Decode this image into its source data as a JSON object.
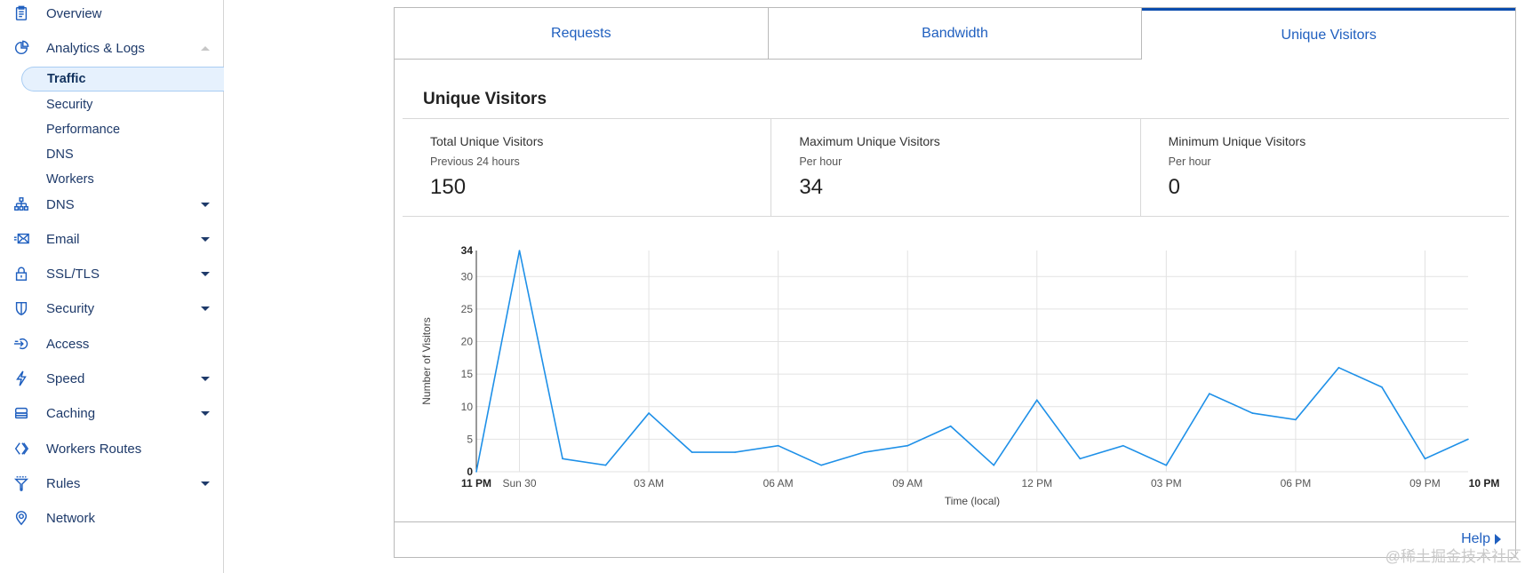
{
  "sidebar": {
    "items": [
      {
        "label": "Overview",
        "icon": "clipboard-icon",
        "caret": "none"
      },
      {
        "label": "Analytics & Logs",
        "icon": "pie-chart-icon",
        "caret": "up"
      },
      {
        "label": "DNS",
        "icon": "sitemap-icon",
        "caret": "down"
      },
      {
        "label": "Email",
        "icon": "mail-icon",
        "caret": "down"
      },
      {
        "label": "SSL/TLS",
        "icon": "lock-icon",
        "caret": "down"
      },
      {
        "label": "Security",
        "icon": "shield-icon",
        "caret": "down"
      },
      {
        "label": "Access",
        "icon": "access-icon",
        "caret": "none"
      },
      {
        "label": "Speed",
        "icon": "lightning-icon",
        "caret": "down"
      },
      {
        "label": "Caching",
        "icon": "server-icon",
        "caret": "down"
      },
      {
        "label": "Workers Routes",
        "icon": "workers-icon",
        "caret": "none"
      },
      {
        "label": "Rules",
        "icon": "filter-icon",
        "caret": "down"
      },
      {
        "label": "Network",
        "icon": "location-pin-icon",
        "caret": "none"
      }
    ],
    "sub_items": [
      {
        "label": "Traffic",
        "active": true
      },
      {
        "label": "Security",
        "active": false
      },
      {
        "label": "Performance",
        "active": false
      },
      {
        "label": "DNS",
        "active": false
      },
      {
        "label": "Workers",
        "active": false
      }
    ]
  },
  "tabs": [
    {
      "label": "Requests",
      "active": false
    },
    {
      "label": "Bandwidth",
      "active": false
    },
    {
      "label": "Unique Visitors",
      "active": true
    }
  ],
  "section_title": "Unique Visitors",
  "stats": [
    {
      "title": "Total Unique Visitors",
      "subtitle": "Previous 24 hours",
      "value": "150"
    },
    {
      "title": "Maximum Unique Visitors",
      "subtitle": "Per hour",
      "value": "34"
    },
    {
      "title": "Minimum Unique Visitors",
      "subtitle": "Per hour",
      "value": "0"
    }
  ],
  "help_label": "Help",
  "watermark": "@稀土掘金技术社区",
  "colors": {
    "accent": "#1f5fbf",
    "line": "#1e90e8",
    "active_tab_border": "#0a4cad"
  },
  "chart_data": {
    "type": "line",
    "title": "",
    "xlabel": "Time (local)",
    "ylabel": "Number of Visitors",
    "ylim": [
      0,
      34
    ],
    "y_ticks": [
      0,
      5,
      10,
      15,
      20,
      25,
      30,
      34
    ],
    "x": [
      "11 PM",
      "12 AM",
      "01 AM",
      "02 AM",
      "03 AM",
      "04 AM",
      "05 AM",
      "06 AM",
      "07 AM",
      "08 AM",
      "09 AM",
      "10 AM",
      "11 AM",
      "12 PM",
      "01 PM",
      "02 PM",
      "03 PM",
      "04 PM",
      "05 PM",
      "06 PM",
      "07 PM",
      "08 PM",
      "09 PM",
      "10 PM"
    ],
    "x_tick_labels": [
      {
        "index": 0,
        "label": "11 PM",
        "bold": true
      },
      {
        "index": 1,
        "label": "Sun 30",
        "bold": false
      },
      {
        "index": 4,
        "label": "03 AM",
        "bold": false
      },
      {
        "index": 7,
        "label": "06 AM",
        "bold": false
      },
      {
        "index": 10,
        "label": "09 AM",
        "bold": false
      },
      {
        "index": 13,
        "label": "12 PM",
        "bold": false
      },
      {
        "index": 16,
        "label": "03 PM",
        "bold": false
      },
      {
        "index": 19,
        "label": "06 PM",
        "bold": false
      },
      {
        "index": 22,
        "label": "09 PM",
        "bold": false
      },
      {
        "index": 23,
        "label": "10 PM",
        "bold": true
      }
    ],
    "series": [
      {
        "name": "Unique Visitors",
        "values": [
          0,
          34,
          2,
          1,
          9,
          3,
          3,
          4,
          1,
          3,
          4,
          7,
          1,
          11,
          2,
          4,
          1,
          12,
          9,
          8,
          16,
          13,
          2,
          5
        ]
      }
    ],
    "grid": true,
    "legend": "none"
  }
}
